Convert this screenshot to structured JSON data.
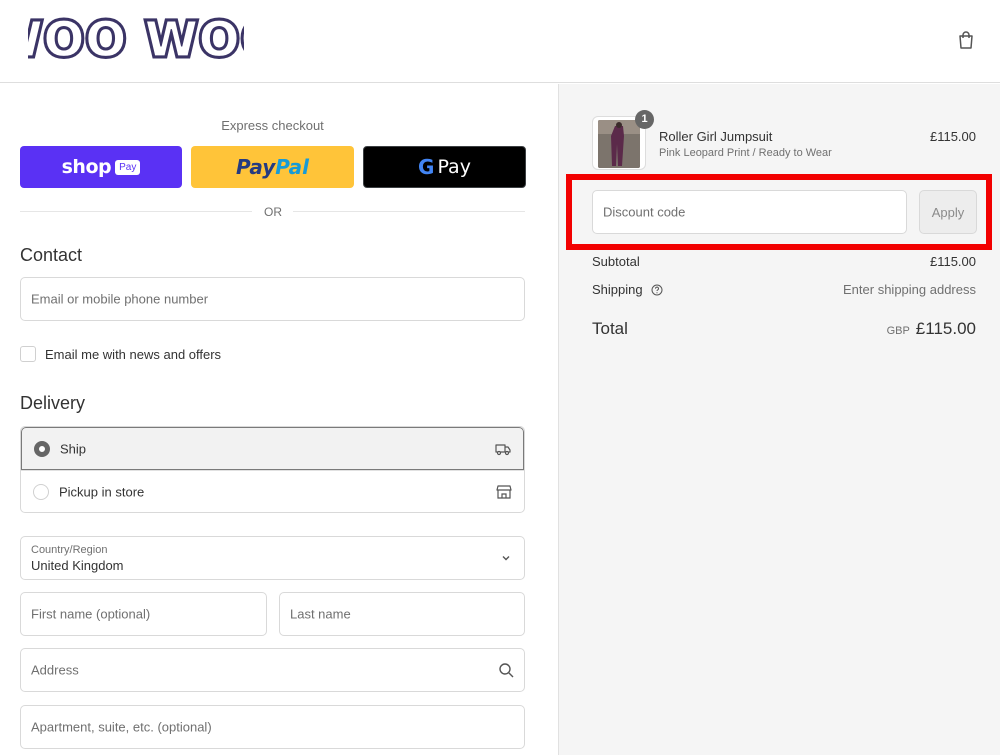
{
  "header": {
    "logo_text": "WOO WOO",
    "cart_icon": "shopping-bag-icon"
  },
  "express": {
    "title": "Express checkout",
    "shop_pay": {
      "word": "shop",
      "badge": "Pay"
    },
    "paypal": {
      "pay": "Pay",
      "pal": "Pal"
    },
    "gpay": {
      "g": "G",
      "word": "Pay"
    },
    "or": "OR"
  },
  "contact": {
    "title": "Contact",
    "email_placeholder": "Email or mobile phone number",
    "newsletter_label": "Email me with news and offers"
  },
  "delivery": {
    "title": "Delivery",
    "options": [
      {
        "label": "Ship",
        "selected": true,
        "icon": "truck-icon"
      },
      {
        "label": "Pickup in store",
        "selected": false,
        "icon": "store-icon"
      }
    ],
    "country_label": "Country/Region",
    "country_value": "United Kingdom",
    "first_name_placeholder": "First name (optional)",
    "last_name_placeholder": "Last name",
    "address_placeholder": "Address",
    "apartment_placeholder": "Apartment, suite, etc. (optional)"
  },
  "summary": {
    "product": {
      "name": "Roller Girl Jumpsuit",
      "variant": "Pink Leopard Print / Ready to Wear",
      "price": "£115.00",
      "quantity": "1"
    },
    "discount_placeholder": "Discount code",
    "apply_label": "Apply",
    "subtotal_label": "Subtotal",
    "subtotal_value": "£115.00",
    "shipping_label": "Shipping",
    "shipping_value": "Enter shipping address",
    "total_label": "Total",
    "total_currency": "GBP",
    "total_value": "£115.00"
  },
  "colors": {
    "shop_pay": "#5a31f4",
    "paypal": "#ffc439",
    "gpay": "#000000",
    "highlight": "#f20000",
    "logo": "#3b3466"
  }
}
